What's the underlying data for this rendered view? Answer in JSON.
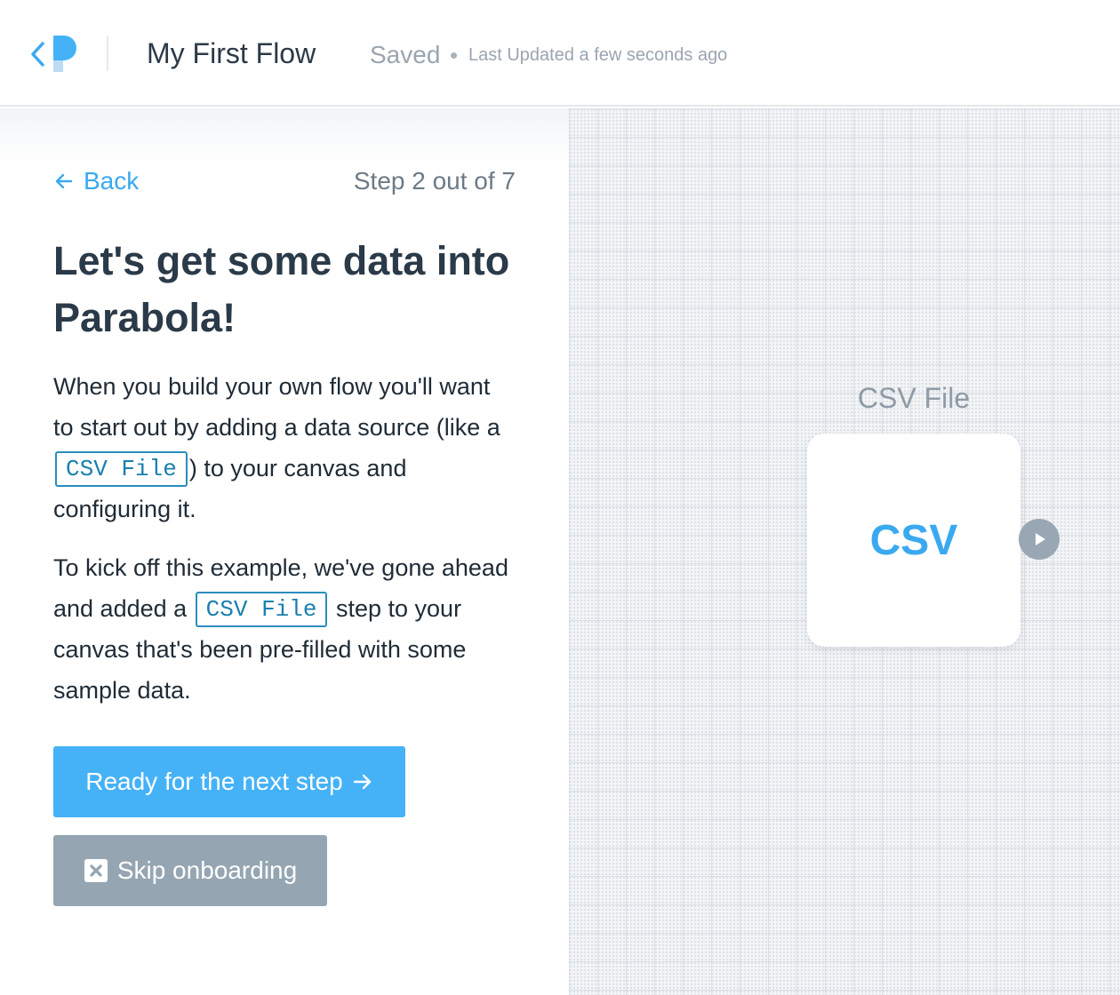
{
  "header": {
    "flow_title": "My First Flow",
    "save_status": "Saved",
    "last_updated": "Last Updated a few seconds ago"
  },
  "onboarding": {
    "back_label": "Back",
    "step_counter": "Step 2 out of 7",
    "heading": "Let's get some data into Parabola!",
    "para1": {
      "before": "When you build your own flow you'll want to start out by adding a data source (like a ",
      "code": "CSV File",
      "after": ") to your canvas and configuring it."
    },
    "para2": {
      "before": "To kick off this example, we've gone ahead and added a ",
      "code": "CSV File",
      "after": " step to your canvas that's been pre-filled with some sample data."
    },
    "next_button_label": "Ready for the next step",
    "skip_button_label": "Skip onboarding"
  },
  "canvas": {
    "node": {
      "label": "CSV File",
      "card_text": "CSV"
    }
  },
  "colors": {
    "accent": "#45b2f7",
    "link": "#3aa9f0",
    "skip_button": "#95a6b2",
    "heading_text": "#2b3a48",
    "canvas_bg": "#f2f4f6"
  },
  "icons": {
    "logo": "parabola-logo-icon",
    "back": "arrow-left-icon",
    "next": "arrow-right-icon",
    "skip": "close-box-icon",
    "port": "play-icon"
  }
}
